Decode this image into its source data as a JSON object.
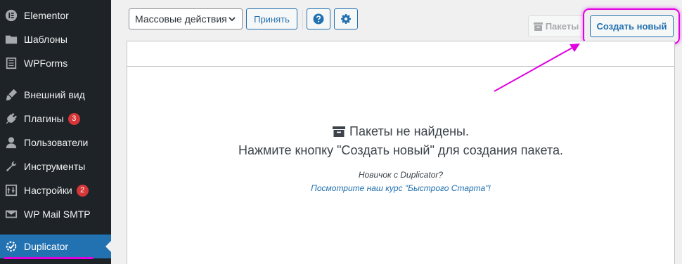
{
  "sidebar": {
    "items": [
      {
        "label": "Elementor",
        "icon": "elementor-icon"
      },
      {
        "label": "Шаблоны",
        "icon": "folder-icon"
      },
      {
        "label": "WPForms",
        "icon": "forms-icon"
      },
      {
        "label": "Внешний вид",
        "icon": "brush-icon"
      },
      {
        "label": "Плагины",
        "icon": "plug-icon",
        "badge": "3"
      },
      {
        "label": "Пользователи",
        "icon": "user-icon"
      },
      {
        "label": "Инструменты",
        "icon": "wrench-icon"
      },
      {
        "label": "Настройки",
        "icon": "settings-icon",
        "badge": "2"
      },
      {
        "label": "WP Mail SMTP",
        "icon": "mail-icon"
      },
      {
        "label": "Duplicator",
        "icon": "duplicator-icon",
        "active": true
      }
    ]
  },
  "toolbar": {
    "bulk_actions": "Массовые действия",
    "apply_label": "Принять",
    "help_icon": "help-icon",
    "settings_icon": "gear-icon",
    "packages_label": "Пакеты",
    "create_new_label": "Создать новый"
  },
  "main": {
    "empty_title": "Пакеты не найдены.",
    "empty_subtitle": "Нажмите кнопку \"Создать новый\" для создания пакета.",
    "newbie_text": "Новичок с Duplicator?",
    "course_link": "Посмотрите наш курс \"Быстрого Старта\"!"
  },
  "colors": {
    "sidebar_bg": "#1d2327",
    "accent": "#2271b1",
    "badge": "#d63638",
    "annotation": "#e100e1"
  }
}
